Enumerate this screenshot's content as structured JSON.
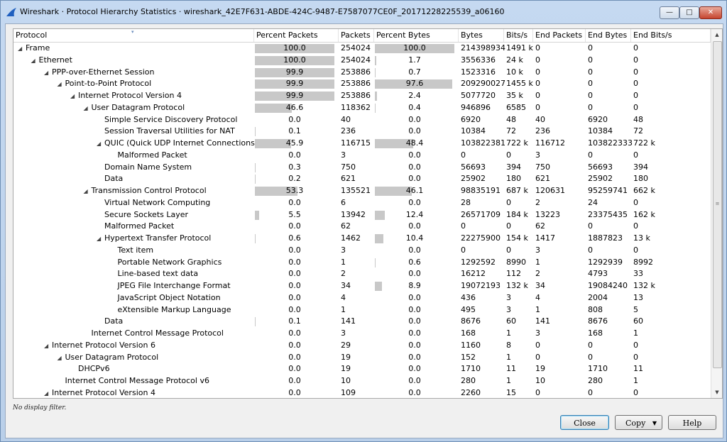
{
  "window": {
    "title": "Wireshark · Protocol Hierarchy Statistics · wireshark_42E7F631-ABDE-424C-9487-E7587077CE0F_20171228225539_a06160",
    "minimize_glyph": "—",
    "maximize_glyph": "□",
    "close_glyph": "✕"
  },
  "columns": [
    "Protocol",
    "Percent Packets",
    "Packets",
    "Percent Bytes",
    "Bytes",
    "Bits/s",
    "End Packets",
    "End Bytes",
    "End Bits/s"
  ],
  "rows": [
    {
      "depth": 0,
      "exp": "open",
      "name": "Frame",
      "pp": "100.0",
      "ppv": 100.0,
      "pk": "254024",
      "pb": "100.0",
      "pbv": 100.0,
      "by": "214398934",
      "bs": "1491 k",
      "ep": "0",
      "eb": "0",
      "ebs": "0"
    },
    {
      "depth": 1,
      "exp": "open",
      "name": "Ethernet",
      "pp": "100.0",
      "ppv": 100.0,
      "pk": "254024",
      "pb": "1.7",
      "pbv": 1.7,
      "by": "3556336",
      "bs": "24 k",
      "ep": "0",
      "eb": "0",
      "ebs": "0"
    },
    {
      "depth": 2,
      "exp": "open",
      "name": "PPP-over-Ethernet Session",
      "pp": "99.9",
      "ppv": 99.9,
      "pk": "253886",
      "pb": "0.7",
      "pbv": 0.7,
      "by": "1523316",
      "bs": "10 k",
      "ep": "0",
      "eb": "0",
      "ebs": "0"
    },
    {
      "depth": 3,
      "exp": "open",
      "name": "Point-to-Point Protocol",
      "pp": "99.9",
      "ppv": 99.9,
      "pk": "253886",
      "pb": "97.6",
      "pbv": 97.6,
      "by": "209290027",
      "bs": "1455 k",
      "ep": "0",
      "eb": "0",
      "ebs": "0"
    },
    {
      "depth": 4,
      "exp": "open",
      "name": "Internet Protocol Version 4",
      "pp": "99.9",
      "ppv": 99.9,
      "pk": "253886",
      "pb": "2.4",
      "pbv": 2.4,
      "by": "5077720",
      "bs": "35 k",
      "ep": "0",
      "eb": "0",
      "ebs": "0"
    },
    {
      "depth": 5,
      "exp": "open",
      "name": "User Datagram Protocol",
      "pp": "46.6",
      "ppv": 46.6,
      "pk": "118362",
      "pb": "0.4",
      "pbv": 0.4,
      "by": "946896",
      "bs": "6585",
      "ep": "0",
      "eb": "0",
      "ebs": "0"
    },
    {
      "depth": 6,
      "exp": "none",
      "name": "Simple Service Discovery Protocol",
      "pp": "0.0",
      "ppv": 0.0,
      "pk": "40",
      "pb": "0.0",
      "pbv": 0.0,
      "by": "6920",
      "bs": "48",
      "ep": "40",
      "eb": "6920",
      "ebs": "48"
    },
    {
      "depth": 6,
      "exp": "none",
      "name": "Session Traversal Utilities for NAT",
      "pp": "0.1",
      "ppv": 0.1,
      "pk": "236",
      "pb": "0.0",
      "pbv": 0.0,
      "by": "10384",
      "bs": "72",
      "ep": "236",
      "eb": "10384",
      "ebs": "72"
    },
    {
      "depth": 6,
      "exp": "open",
      "name": "QUIC (Quick UDP Internet Connections)",
      "pp": "45.9",
      "ppv": 45.9,
      "pk": "116715",
      "pb": "48.4",
      "pbv": 48.4,
      "by": "103822381",
      "bs": "722 k",
      "ep": "116712",
      "eb": "103822333",
      "ebs": "722 k"
    },
    {
      "depth": 7,
      "exp": "none",
      "name": "Malformed Packet",
      "pp": "0.0",
      "ppv": 0.0,
      "pk": "3",
      "pb": "0.0",
      "pbv": 0.0,
      "by": "0",
      "bs": "0",
      "ep": "3",
      "eb": "0",
      "ebs": "0"
    },
    {
      "depth": 6,
      "exp": "none",
      "name": "Domain Name System",
      "pp": "0.3",
      "ppv": 0.3,
      "pk": "750",
      "pb": "0.0",
      "pbv": 0.0,
      "by": "56693",
      "bs": "394",
      "ep": "750",
      "eb": "56693",
      "ebs": "394"
    },
    {
      "depth": 6,
      "exp": "none",
      "name": "Data",
      "pp": "0.2",
      "ppv": 0.2,
      "pk": "621",
      "pb": "0.0",
      "pbv": 0.0,
      "by": "25902",
      "bs": "180",
      "ep": "621",
      "eb": "25902",
      "ebs": "180"
    },
    {
      "depth": 5,
      "exp": "open",
      "name": "Transmission Control Protocol",
      "pp": "53.3",
      "ppv": 53.3,
      "pk": "135521",
      "pb": "46.1",
      "pbv": 46.1,
      "by": "98835191",
      "bs": "687 k",
      "ep": "120631",
      "eb": "95259741",
      "ebs": "662 k"
    },
    {
      "depth": 6,
      "exp": "none",
      "name": "Virtual Network Computing",
      "pp": "0.0",
      "ppv": 0.0,
      "pk": "6",
      "pb": "0.0",
      "pbv": 0.0,
      "by": "28",
      "bs": "0",
      "ep": "2",
      "eb": "24",
      "ebs": "0"
    },
    {
      "depth": 6,
      "exp": "none",
      "name": "Secure Sockets Layer",
      "pp": "5.5",
      "ppv": 5.5,
      "pk": "13942",
      "pb": "12.4",
      "pbv": 12.4,
      "by": "26571709",
      "bs": "184 k",
      "ep": "13223",
      "eb": "23375435",
      "ebs": "162 k"
    },
    {
      "depth": 6,
      "exp": "none",
      "name": "Malformed Packet",
      "pp": "0.0",
      "ppv": 0.0,
      "pk": "62",
      "pb": "0.0",
      "pbv": 0.0,
      "by": "0",
      "bs": "0",
      "ep": "62",
      "eb": "0",
      "ebs": "0"
    },
    {
      "depth": 6,
      "exp": "open",
      "name": "Hypertext Transfer Protocol",
      "pp": "0.6",
      "ppv": 0.6,
      "pk": "1462",
      "pb": "10.4",
      "pbv": 10.4,
      "by": "22275900",
      "bs": "154 k",
      "ep": "1417",
      "eb": "1887823",
      "ebs": "13 k"
    },
    {
      "depth": 7,
      "exp": "none",
      "name": "Text item",
      "pp": "0.0",
      "ppv": 0.0,
      "pk": "3",
      "pb": "0.0",
      "pbv": 0.0,
      "by": "0",
      "bs": "0",
      "ep": "3",
      "eb": "0",
      "ebs": "0"
    },
    {
      "depth": 7,
      "exp": "none",
      "name": "Portable Network Graphics",
      "pp": "0.0",
      "ppv": 0.0,
      "pk": "1",
      "pb": "0.6",
      "pbv": 0.6,
      "by": "1292592",
      "bs": "8990",
      "ep": "1",
      "eb": "1292939",
      "ebs": "8992"
    },
    {
      "depth": 7,
      "exp": "none",
      "name": "Line-based text data",
      "pp": "0.0",
      "ppv": 0.0,
      "pk": "2",
      "pb": "0.0",
      "pbv": 0.0,
      "by": "16212",
      "bs": "112",
      "ep": "2",
      "eb": "4793",
      "ebs": "33"
    },
    {
      "depth": 7,
      "exp": "none",
      "name": "JPEG File Interchange Format",
      "pp": "0.0",
      "ppv": 0.0,
      "pk": "34",
      "pb": "8.9",
      "pbv": 8.9,
      "by": "19072193",
      "bs": "132 k",
      "ep": "34",
      "eb": "19084240",
      "ebs": "132 k"
    },
    {
      "depth": 7,
      "exp": "none",
      "name": "JavaScript Object Notation",
      "pp": "0.0",
      "ppv": 0.0,
      "pk": "4",
      "pb": "0.0",
      "pbv": 0.0,
      "by": "436",
      "bs": "3",
      "ep": "4",
      "eb": "2004",
      "ebs": "13"
    },
    {
      "depth": 7,
      "exp": "none",
      "name": "eXtensible Markup Language",
      "pp": "0.0",
      "ppv": 0.0,
      "pk": "1",
      "pb": "0.0",
      "pbv": 0.0,
      "by": "495",
      "bs": "3",
      "ep": "1",
      "eb": "808",
      "ebs": "5"
    },
    {
      "depth": 6,
      "exp": "none",
      "name": "Data",
      "pp": "0.1",
      "ppv": 0.1,
      "pk": "141",
      "pb": "0.0",
      "pbv": 0.0,
      "by": "8676",
      "bs": "60",
      "ep": "141",
      "eb": "8676",
      "ebs": "60"
    },
    {
      "depth": 5,
      "exp": "none",
      "name": "Internet Control Message Protocol",
      "pp": "0.0",
      "ppv": 0.0,
      "pk": "3",
      "pb": "0.0",
      "pbv": 0.0,
      "by": "168",
      "bs": "1",
      "ep": "3",
      "eb": "168",
      "ebs": "1"
    },
    {
      "depth": 2,
      "exp": "open",
      "name": "Internet Protocol Version 6",
      "pp": "0.0",
      "ppv": 0.0,
      "pk": "29",
      "pb": "0.0",
      "pbv": 0.0,
      "by": "1160",
      "bs": "8",
      "ep": "0",
      "eb": "0",
      "ebs": "0"
    },
    {
      "depth": 3,
      "exp": "open",
      "name": "User Datagram Protocol",
      "pp": "0.0",
      "ppv": 0.0,
      "pk": "19",
      "pb": "0.0",
      "pbv": 0.0,
      "by": "152",
      "bs": "1",
      "ep": "0",
      "eb": "0",
      "ebs": "0"
    },
    {
      "depth": 4,
      "exp": "none",
      "name": "DHCPv6",
      "pp": "0.0",
      "ppv": 0.0,
      "pk": "19",
      "pb": "0.0",
      "pbv": 0.0,
      "by": "1710",
      "bs": "11",
      "ep": "19",
      "eb": "1710",
      "ebs": "11"
    },
    {
      "depth": 3,
      "exp": "none",
      "name": "Internet Control Message Protocol v6",
      "pp": "0.0",
      "ppv": 0.0,
      "pk": "10",
      "pb": "0.0",
      "pbv": 0.0,
      "by": "280",
      "bs": "1",
      "ep": "10",
      "eb": "280",
      "ebs": "1"
    },
    {
      "depth": 2,
      "exp": "open",
      "name": "Internet Protocol Version 4",
      "pp": "0.0",
      "ppv": 0.0,
      "pk": "109",
      "pb": "0.0",
      "pbv": 0.0,
      "by": "2260",
      "bs": "15",
      "ep": "0",
      "eb": "0",
      "ebs": "0"
    }
  ],
  "scrollbar": {
    "up_glyph": "▲",
    "down_glyph": "▼",
    "grip_glyph": "≡"
  },
  "status_text": "No display filter.",
  "buttons": {
    "close_label": "Close",
    "copy_label": "Copy",
    "copy_caret": "▼",
    "help_label": "Help"
  },
  "colors": {
    "bar": "#c8c8c8",
    "title_bar": "#c5d9f1",
    "close_button": "#c6452f"
  }
}
